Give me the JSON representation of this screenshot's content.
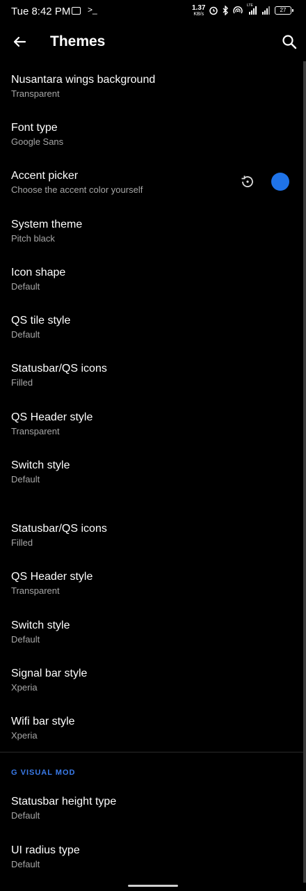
{
  "status_bar": {
    "time": "Tue 8:42 PM",
    "terminal_glyph": ">_",
    "net_speed_value": "1.37",
    "net_speed_unit": "KB/s",
    "lte_label": "LTE",
    "battery_level": "27"
  },
  "app_bar": {
    "title": "Themes",
    "back_icon": "arrow-left-icon",
    "search_icon": "search-icon"
  },
  "settings": [
    {
      "title": "Nusantara wings background",
      "summary": "Transparent"
    },
    {
      "title": "Font type",
      "summary": "Google Sans"
    },
    {
      "title": "Accent picker",
      "summary": "Choose the accent color yourself"
    },
    {
      "title": "System theme",
      "summary": "Pitch black"
    },
    {
      "title": "Icon shape",
      "summary": "Default"
    },
    {
      "title": "QS tile style",
      "summary": "Default"
    },
    {
      "title": "Statusbar/QS icons",
      "summary": "Filled"
    },
    {
      "title": "QS Header style",
      "summary": "Transparent"
    },
    {
      "title": "Switch style",
      "summary": "Default"
    },
    {
      "title": "Statusbar/QS icons",
      "summary": "Filled"
    },
    {
      "title": "QS Header style",
      "summary": "Transparent"
    },
    {
      "title": "Switch style",
      "summary": "Default"
    },
    {
      "title": "Signal bar style",
      "summary": "Xperia"
    },
    {
      "title": "Wifi bar style",
      "summary": "Xperia"
    }
  ],
  "section": {
    "header": "G VISUAL MOD",
    "items": [
      {
        "title": "Statusbar height type",
        "summary": "Default"
      },
      {
        "title": "UI radius type",
        "summary": "Default"
      }
    ]
  },
  "accent": {
    "color": "#1f73e8",
    "reset_icon": "restore-icon"
  },
  "colors": {
    "background": "#000000",
    "section_header": "#3a7bea",
    "summary_text": "#a7a7a7"
  }
}
